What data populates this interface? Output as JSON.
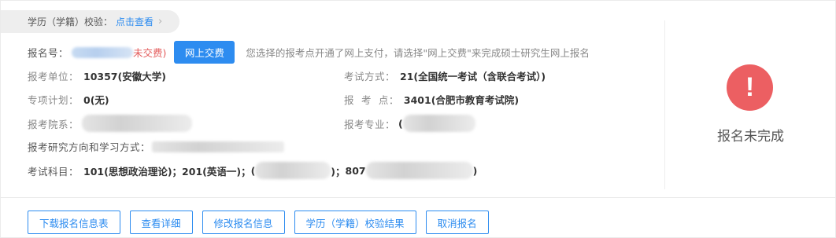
{
  "verify": {
    "label": "学历（学籍）校验：",
    "link": "点击查看",
    "chevron": "›"
  },
  "registration": {
    "number_label": "报名号：",
    "status": "未交费)",
    "pay_button": "网上交费",
    "notice": "您选择的报考点开通了网上支付，请选择\"网上交费\"来完成硕士研究生网上报名"
  },
  "fields": {
    "unit_label": "报考单位：",
    "unit_value": "10357(安徽大学)",
    "exam_method_label": "考试方式：",
    "exam_method_value": "21(全国统一考试（含联合考试）)",
    "special_plan_label": "专项计划：",
    "special_plan_value": "0(无)",
    "exam_site_label": "报  考  点：",
    "exam_site_value": "3401(合肥市教育考试院)",
    "department_label": "报考院系：",
    "major_label": "报考专业：",
    "major_prefix": "(",
    "direction_label": "报考研究方向和学习方式：",
    "subjects_label": "考试科目：",
    "subject_1": "101(思想政治理论)；",
    "subject_2": "201(英语一)；",
    "subject_3_prefix": "(",
    "subject_3_suffix": ")；",
    "subject_4_prefix": "807",
    "subject_4_suffix": ")"
  },
  "status_panel": {
    "icon": "exclamation-icon",
    "text": "报名未完成",
    "color": "#ec5f62"
  },
  "actions": {
    "download": "下载报名信息表",
    "details": "查看详细",
    "modify": "修改报名信息",
    "verify_result": "学历（学籍）校验结果",
    "cancel": "取消报名"
  },
  "colors": {
    "accent": "#2d8cf0",
    "warning": "#ec5f62",
    "unpaid": "#e35b5b"
  }
}
